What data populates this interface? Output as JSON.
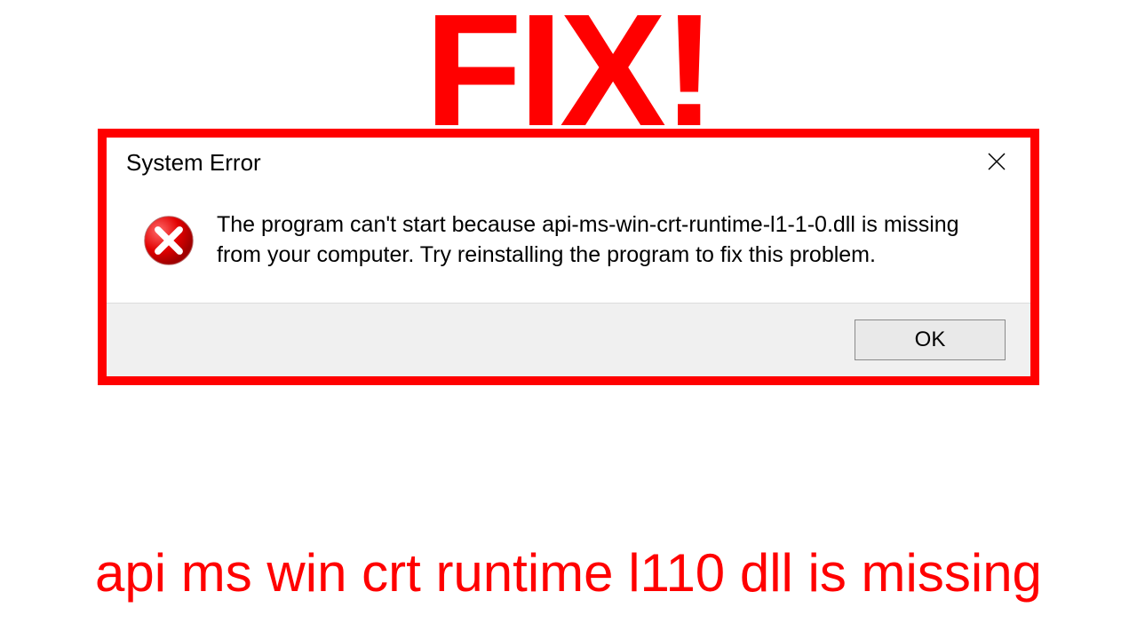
{
  "banner": {
    "text": "FIX!"
  },
  "dialog": {
    "title": "System Error",
    "message": "The program can't start because api-ms-win-crt-runtime-l1-1-0.dll is missing from your computer. Try reinstalling the program to fix this problem.",
    "ok_label": "OK"
  },
  "caption": {
    "text": "api ms win crt runtime l110 dll is missing"
  },
  "colors": {
    "accent": "#ff0000"
  }
}
